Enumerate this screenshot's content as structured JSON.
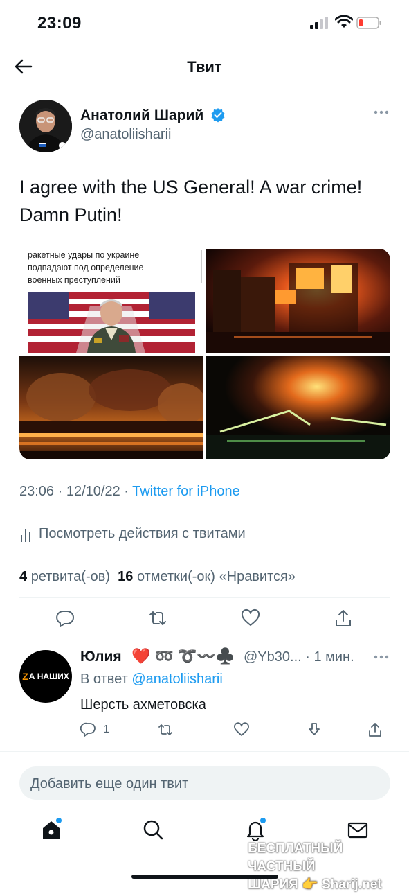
{
  "status": {
    "time": "23:09"
  },
  "header": {
    "title": "Твит"
  },
  "tweet": {
    "author_name": "Анатолий Шарий",
    "handle": "@anatoliisharii",
    "text": "I agree with the US General! A war crime! Damn Putin!",
    "media_caption": [
      "ракетные удары по украине",
      "подпадают под определение",
      "военных преступлений"
    ],
    "time": "23:06",
    "date": "12/10/22",
    "source": "Twitter for iPhone",
    "analytics_label": "Посмотреть действия с твитами",
    "retweets_count": "4",
    "retweets_label": "ретвита(-ов)",
    "likes_count": "16",
    "likes_label": "отметки(-ок) «Нравится»"
  },
  "reply": {
    "avatar_text": "А НАШИХ",
    "avatar_z": "Z",
    "name": "Юлия",
    "name_emoji": "❤️ ➿ ➰〰️♣️",
    "handle_time": "@Yb30... · 1 мин.",
    "reply_to_prefix": "В ответ",
    "reply_to_handle": "@anatoliisharii",
    "text": "Шерсть ахметовска",
    "reply_count": "1"
  },
  "compose": {
    "placeholder": "Добавить еще один твит"
  },
  "watermark": {
    "line1": "БЕСПЛАТНЫЙ ЧАСТНЫЙ",
    "line2": "ШАРИЯ 👉 Sharij.net"
  }
}
